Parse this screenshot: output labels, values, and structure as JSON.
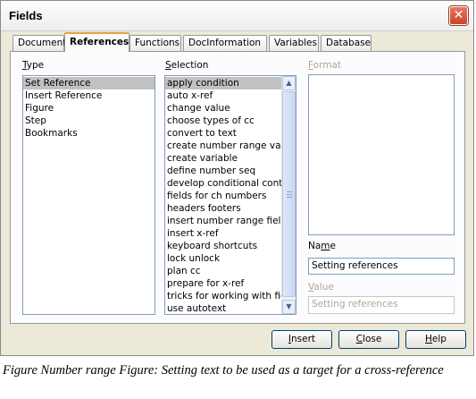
{
  "window": {
    "title": "Fields",
    "close_glyph": "✕"
  },
  "tabs": [
    {
      "label": "Document",
      "active": false
    },
    {
      "label": "References",
      "active": true
    },
    {
      "label": "Functions",
      "active": false
    },
    {
      "label": "DocInformation",
      "active": false
    },
    {
      "label": "Variables",
      "active": false
    },
    {
      "label": "Database",
      "active": false
    }
  ],
  "type_section": {
    "label_first": "T",
    "label_rest": "ype",
    "items": [
      "Set Reference",
      "Insert Reference",
      "Figure",
      "Step",
      "Bookmarks"
    ],
    "selected": "Set Reference"
  },
  "selection_section": {
    "label_first": "S",
    "label_rest": "election",
    "items": [
      "apply condition",
      "auto x-ref",
      "change value",
      "choose types of cc",
      "convert to text",
      "create number range var",
      "create variable",
      "define number seq",
      "develop conditional conter",
      "fields for ch numbers",
      "headers footers",
      "insert number range field",
      "insert x-ref",
      "keyboard shortcuts",
      "lock unlock",
      "plan cc",
      "prepare for x-ref",
      "tricks for working with fielc",
      "use autotext"
    ],
    "selected": "apply condition",
    "scroll_up_glyph": "▲",
    "scroll_down_glyph": "▼"
  },
  "format_section": {
    "label_first": "F",
    "label_rest": "ormat"
  },
  "name_section": {
    "label_pre": "Na",
    "label_ul": "m",
    "label_post": "e",
    "value": "Setting references"
  },
  "value_section": {
    "label_first": "V",
    "label_rest": "alue",
    "value": "Setting references"
  },
  "buttons": {
    "insert": {
      "ul": "I",
      "rest": "nsert"
    },
    "close": {
      "ul": "C",
      "rest": "lose"
    },
    "help": {
      "ul": "H",
      "rest": "elp"
    }
  },
  "caption": "Figure Number range Figure: Setting text to be used as a target for a cross-reference",
  "colors": {
    "selection_bg": "#c1c1c1",
    "dialog_bg": "#ece9d8",
    "close_red": "#c9442a"
  }
}
